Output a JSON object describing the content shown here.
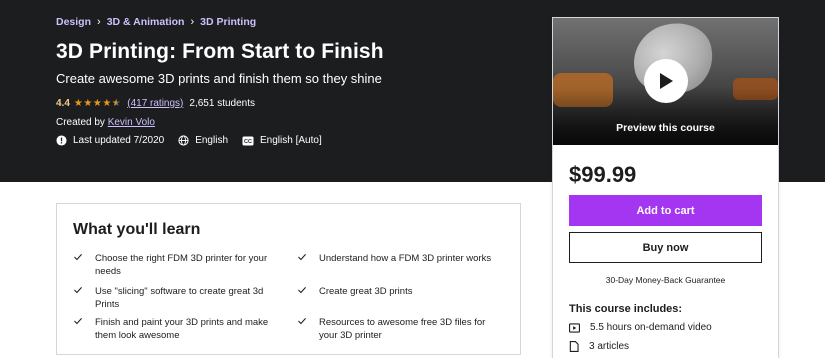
{
  "breadcrumb": {
    "items": [
      "Design",
      "3D & Animation",
      "3D Printing"
    ],
    "separator": "›"
  },
  "course": {
    "title": "3D Printing: From Start to Finish",
    "subtitle": "Create awesome 3D prints and finish them so they shine",
    "rating": "4.4",
    "stars": 4.4,
    "ratings_count": "(417 ratings)",
    "students": "2,651 students",
    "created_prefix": "Created by",
    "author": "Kevin Volo",
    "last_updated": "Last updated 7/2020",
    "language": "English",
    "captions": "English [Auto]"
  },
  "sidebar": {
    "preview_label": "Preview this course",
    "price": "$99.99",
    "add_to_cart": "Add to cart",
    "buy_now": "Buy now",
    "guarantee": "30-Day Money-Back Guarantee",
    "includes_title": "This course includes:",
    "includes": [
      {
        "icon": "video-icon",
        "text": "5.5 hours on-demand video"
      },
      {
        "icon": "article-icon",
        "text": "3 articles"
      }
    ]
  },
  "learn": {
    "title": "What you'll learn",
    "items": [
      "Choose the right FDM 3D printer for your needs",
      "Understand how a FDM 3D printer works",
      "Use \"slicing\" software to create great 3d Prints",
      "Create great 3D prints",
      "Finish and paint your 3D prints and make them look awesome",
      "Resources to awesome free 3D files for your 3D printer"
    ]
  },
  "colors": {
    "hero_bg": "#1c1d1f",
    "accent_purple": "#a435f0",
    "link_lavender": "#cec0fc",
    "rating_gold": "#f3ca8c",
    "star_orange": "#e59819"
  }
}
